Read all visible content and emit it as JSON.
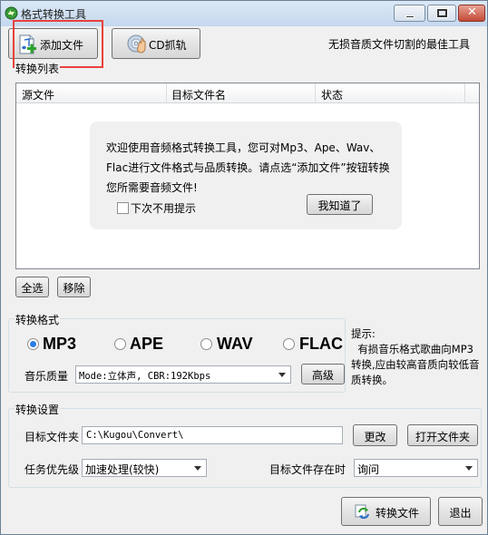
{
  "window": {
    "title": "格式转换工具"
  },
  "toolbar": {
    "add_file_label": "添加文件",
    "cd_rip_label": "CD抓轨",
    "tagline": "无损音质文件切割的最佳工具"
  },
  "list": {
    "section_label": "转换列表",
    "columns": [
      "源文件",
      "目标文件名",
      "状态"
    ],
    "welcome_text": "欢迎使用音频格式转换工具，您可对Mp3、Ape、Wav、Flac进行文件格式与品质转换。请点选“添加文件”按钮转换您所需要音频文件!",
    "dont_show_label": "下次不用提示",
    "dont_show_checked": false,
    "got_it_label": "我知道了",
    "select_all_label": "全选",
    "remove_label": "移除"
  },
  "format": {
    "section_label": "转换格式",
    "options": [
      "MP3",
      "APE",
      "WAV",
      "FLAC"
    ],
    "selected": "MP3",
    "quality_label": "音乐质量",
    "quality_value": "Mode:立体声, CBR:192Kbps",
    "advanced_label": "高级",
    "hint_text": "提示:\n  有损音乐格式歌曲向MP3转换,应由较高音质向较低音质转换。"
  },
  "settings": {
    "section_label": "转换设置",
    "target_folder_label": "目标文件夹",
    "target_folder_value": "C:\\Kugou\\Convert\\",
    "change_label": "更改",
    "open_folder_label": "打开文件夹",
    "priority_label": "任务优先级",
    "priority_value": "加速处理(较快)",
    "exists_label": "目标文件存在时",
    "exists_value": "询问"
  },
  "footer": {
    "convert_label": "转换文件",
    "exit_label": "退出"
  },
  "colors": {
    "highlight": "#e8413b",
    "radio_selected": "#2a7de1"
  }
}
